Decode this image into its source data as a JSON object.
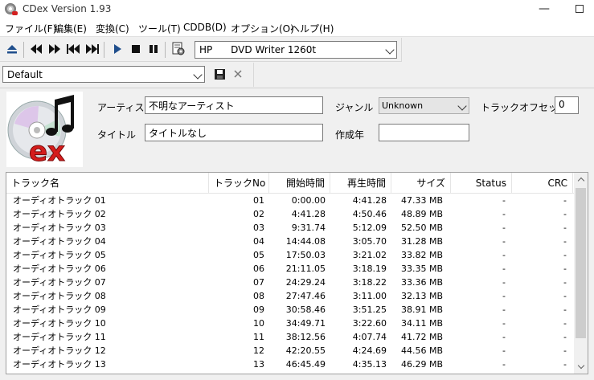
{
  "window": {
    "title": "CDex Version 1.93",
    "minimize": "—"
  },
  "menu": [
    "ファイル(F)",
    "編集(E)",
    "変換(C)",
    "ツール(T)",
    "CDDB(D)",
    "オプション(O)",
    "ヘルプ(H)"
  ],
  "toolbar": {
    "drive": "HP      DVD Writer 1260t"
  },
  "profile": {
    "value": "Default"
  },
  "album": {
    "artist_label": "アーティスト",
    "artist": "不明なアーティスト",
    "title_label": "タイトル",
    "title": "タイトルなし",
    "genre_label": "ジャンル",
    "genre": "Unknown",
    "year_label": "作成年",
    "year": "",
    "offset_label": "トラックオフセット",
    "offset": "0"
  },
  "columns": [
    "トラック名",
    "トラックNo",
    "開始時間",
    "再生時間",
    "サイズ",
    "Status",
    "CRC"
  ],
  "tracks": [
    {
      "name": "オーディオトラック 01",
      "no": "01",
      "start": "0:00.00",
      "duration": "4:41.28",
      "size": "47.33 MB",
      "status": "-",
      "crc": "-"
    },
    {
      "name": "オーディオトラック 02",
      "no": "02",
      "start": "4:41.28",
      "duration": "4:50.46",
      "size": "48.89 MB",
      "status": "-",
      "crc": "-"
    },
    {
      "name": "オーディオトラック 03",
      "no": "03",
      "start": "9:31.74",
      "duration": "5:12.09",
      "size": "52.50 MB",
      "status": "-",
      "crc": "-"
    },
    {
      "name": "オーディオトラック 04",
      "no": "04",
      "start": "14:44.08",
      "duration": "3:05.70",
      "size": "31.28 MB",
      "status": "-",
      "crc": "-"
    },
    {
      "name": "オーディオトラック 05",
      "no": "05",
      "start": "17:50.03",
      "duration": "3:21.02",
      "size": "33.82 MB",
      "status": "-",
      "crc": "-"
    },
    {
      "name": "オーディオトラック 06",
      "no": "06",
      "start": "21:11.05",
      "duration": "3:18.19",
      "size": "33.35 MB",
      "status": "-",
      "crc": "-"
    },
    {
      "name": "オーディオトラック 07",
      "no": "07",
      "start": "24:29.24",
      "duration": "3:18.22",
      "size": "33.36 MB",
      "status": "-",
      "crc": "-"
    },
    {
      "name": "オーディオトラック 08",
      "no": "08",
      "start": "27:47.46",
      "duration": "3:11.00",
      "size": "32.13 MB",
      "status": "-",
      "crc": "-"
    },
    {
      "name": "オーディオトラック 09",
      "no": "09",
      "start": "30:58.46",
      "duration": "3:51.25",
      "size": "38.91 MB",
      "status": "-",
      "crc": "-"
    },
    {
      "name": "オーディオトラック 10",
      "no": "10",
      "start": "34:49.71",
      "duration": "3:22.60",
      "size": "34.11 MB",
      "status": "-",
      "crc": "-"
    },
    {
      "name": "オーディオトラック 11",
      "no": "11",
      "start": "38:12.56",
      "duration": "4:07.74",
      "size": "41.72 MB",
      "status": "-",
      "crc": "-"
    },
    {
      "name": "オーディオトラック 12",
      "no": "12",
      "start": "42:20.55",
      "duration": "4:24.69",
      "size": "44.56 MB",
      "status": "-",
      "crc": "-"
    },
    {
      "name": "オーディオトラック 13",
      "no": "13",
      "start": "46:45.49",
      "duration": "4:35.13",
      "size": "46.29 MB",
      "status": "-",
      "crc": "-"
    }
  ]
}
